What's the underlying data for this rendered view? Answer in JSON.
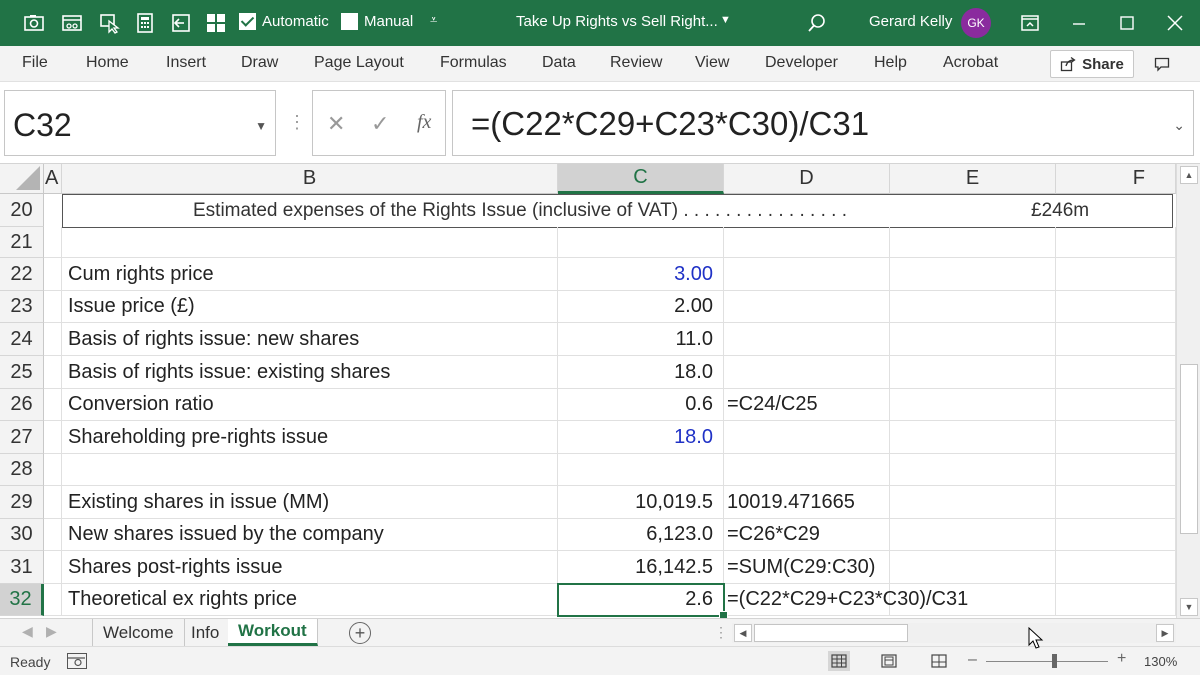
{
  "titlebar": {
    "autocalc_label": "Automatic",
    "manual_label": "Manual",
    "doc_title": "Take Up Rights vs Sell Right...",
    "user_name": "Gerard Kelly",
    "user_initials": "GK"
  },
  "ribbon": {
    "tabs": [
      "File",
      "Home",
      "Insert",
      "Draw",
      "Page Layout",
      "Formulas",
      "Data",
      "Review",
      "View",
      "Developer",
      "Help",
      "Acrobat"
    ],
    "share_label": "Share"
  },
  "formula_bar": {
    "name_box": "C32",
    "fx_label": "fx",
    "formula": "=(C22*C29+C23*C30)/C31"
  },
  "columns": [
    "A",
    "B",
    "C",
    "D",
    "E",
    "F"
  ],
  "selected_column": "C",
  "rows": [
    "20",
    "21",
    "22",
    "23",
    "24",
    "25",
    "26",
    "27",
    "28",
    "29",
    "30",
    "31",
    "32"
  ],
  "selected_row": "32",
  "row20": {
    "text": "Estimated expenses of the Rights Issue (inclusive of VAT) . . . . . . . . . . . . . . . .",
    "value": "£246m"
  },
  "cells": {
    "B22": "Cum rights price",
    "C22": "3.00",
    "B23": "Issue price (£)",
    "C23": "2.00",
    "B24": "Basis of rights issue: new shares",
    "C24": "11.0",
    "B25": "Basis of rights issue: existing shares",
    "C25": "18.0",
    "B26": "Conversion ratio",
    "C26": "0.6",
    "D26": "=C24/C25",
    "B27": "Shareholding pre-rights issue",
    "C27": "18.0",
    "B29": "Existing shares in issue (MM)",
    "C29": "10,019.5",
    "D29": "10019.471665",
    "B30": "New shares issued by the company",
    "C30": "6,123.0",
    "D30": "=C26*C29",
    "B31": "Shares post-rights issue",
    "C31": "16,142.5",
    "D31": "=SUM(C29:C30)",
    "B32": "Theoretical ex rights price",
    "C32": "2.6",
    "D32": "=(C22*C29+C23*C30)/C31"
  },
  "sheets": [
    "Welcome",
    "Info",
    "Workout"
  ],
  "active_sheet": "Workout",
  "status": {
    "ready": "Ready",
    "zoom": "130%"
  },
  "colors": {
    "accent": "#217346",
    "input_blue": "#1f31c6",
    "avatar": "#8a2b9e"
  }
}
